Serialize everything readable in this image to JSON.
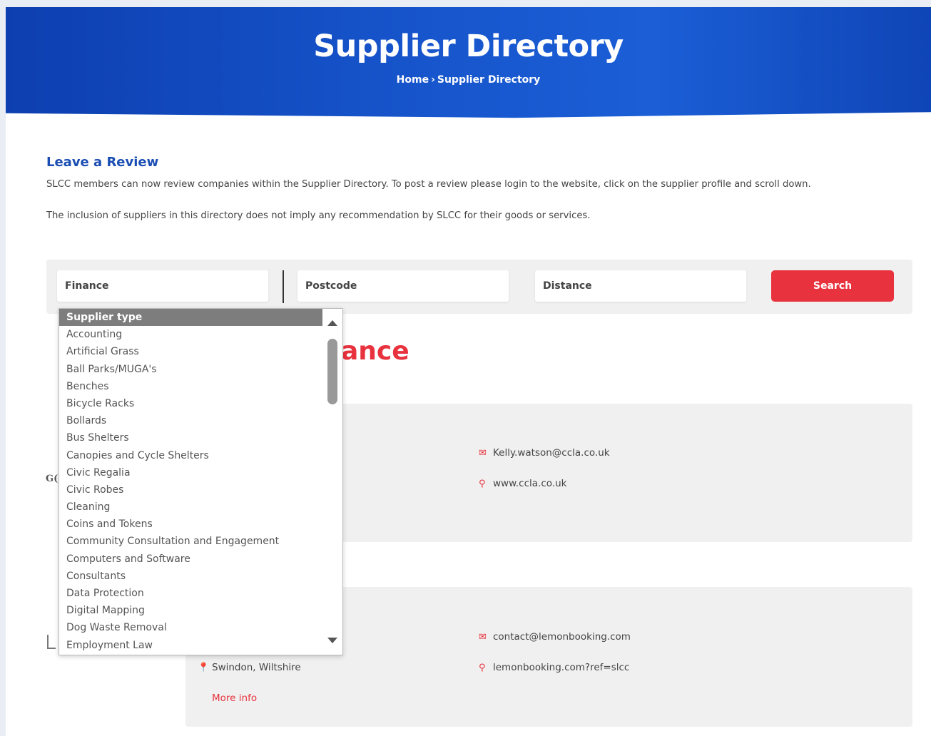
{
  "hero": {
    "title": "Supplier Directory",
    "breadcrumb_home": "Home",
    "breadcrumb_sep": "›",
    "breadcrumb_current": "Supplier Directory"
  },
  "review": {
    "heading": "Leave a Review",
    "paragraph1": "SLCC members can now review companies within the Supplier Directory. To post a review please login to the website, click on the supplier profile and scroll down.",
    "paragraph2": "The inclusion of suppliers in this directory does not imply any recommendation by SLCC for their goods or services."
  },
  "search": {
    "supplier_type_value": "Finance",
    "postcode_placeholder": "Postcode",
    "distance_value": "Distance",
    "button_label": "Search"
  },
  "results_heading_visible": "ance",
  "cards": [
    {
      "name_stub": "G(",
      "email": "Kelly.watson@ccla.co.uk",
      "website": "www.ccla.co.uk"
    },
    {
      "email": "contact@lemonbooking.com",
      "website": "lemonbooking.com?ref=slcc",
      "location": "Swindon, Wiltshire",
      "more_info": "More info"
    }
  ],
  "dropdown": {
    "options": [
      "Supplier type",
      "Accounting",
      "Artificial Grass",
      "Ball Parks/MUGA's",
      "Benches",
      "Bicycle Racks",
      "Bollards",
      "Bus Shelters",
      "Canopies and Cycle Shelters",
      "Civic Regalia",
      "Civic Robes",
      "Cleaning",
      "Coins and Tokens",
      "Community Consultation and Engagement",
      "Computers and Software",
      "Consultants",
      "Data Protection",
      "Digital Mapping",
      "Dog Waste Removal",
      "Employment Law"
    ],
    "selected_index": 0
  },
  "icons": {
    "email": "envelope-icon",
    "website": "search-icon",
    "location": "map-pin-icon"
  },
  "colors": {
    "brand_blue": "#1755cc",
    "accent_red": "#e8323d",
    "heading_blue": "#1a4db3"
  }
}
